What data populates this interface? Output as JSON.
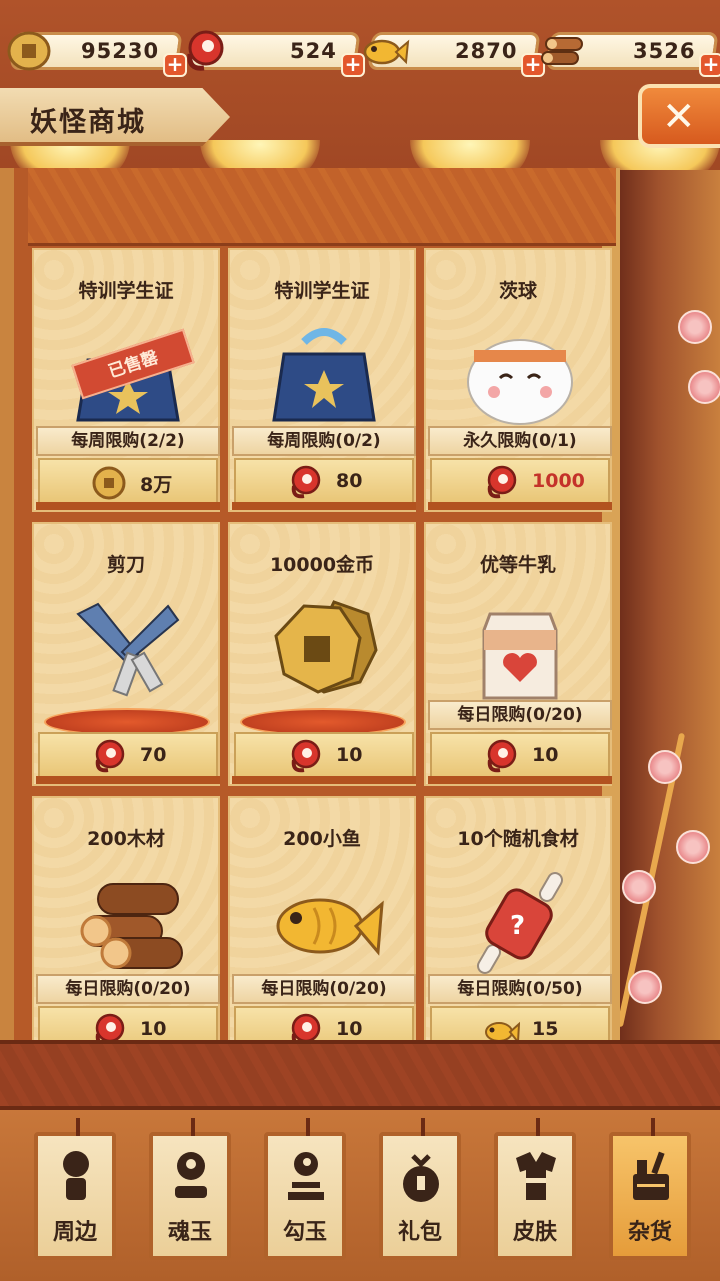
{
  "currencies": [
    {
      "name": "gold-coin",
      "value": "95230"
    },
    {
      "name": "magatama",
      "value": "524"
    },
    {
      "name": "fish",
      "value": "2870"
    },
    {
      "name": "wood",
      "value": "3526"
    }
  ],
  "title": "妖怪商城",
  "close_label": "✕",
  "items": [
    {
      "name": "特训学生证",
      "limit": "每周限购(2/2)",
      "price": "8万",
      "currency": "gold-coin",
      "sold_out": "已售罄"
    },
    {
      "name": "特训学生证",
      "limit": "每周限购(0/2)",
      "price": "80",
      "currency": "magatama"
    },
    {
      "name": "茨球",
      "limit": "永久限购(0/1)",
      "price": "1000",
      "currency": "magatama"
    },
    {
      "name": "剪刀",
      "limit": "",
      "price": "70",
      "currency": "magatama"
    },
    {
      "name": "10000金币",
      "limit": "",
      "price": "10",
      "currency": "magatama"
    },
    {
      "name": "优等牛乳",
      "limit": "每日限购(0/20)",
      "price": "10",
      "currency": "magatama"
    },
    {
      "name": "200木材",
      "limit": "每日限购(0/20)",
      "price": "10",
      "currency": "magatama"
    },
    {
      "name": "200小鱼",
      "limit": "每日限购(0/20)",
      "price": "10",
      "currency": "magatama"
    },
    {
      "name": "10个随机食材",
      "limit": "每日限购(0/50)",
      "price": "15",
      "currency": "fish"
    }
  ],
  "tabs": [
    {
      "label": "周边",
      "icon": "doll-icon"
    },
    {
      "label": "魂玉",
      "icon": "soul-jade-icon"
    },
    {
      "label": "勾玉",
      "icon": "magatama-icon"
    },
    {
      "label": "礼包",
      "icon": "gift-bag-icon"
    },
    {
      "label": "皮肤",
      "icon": "kimono-icon"
    },
    {
      "label": "杂货",
      "icon": "goods-basket-icon",
      "active": true
    }
  ],
  "colors": {
    "accent": "#d75a1e",
    "price_red": "#c4322a",
    "card_bg": "#f3d9a6"
  }
}
